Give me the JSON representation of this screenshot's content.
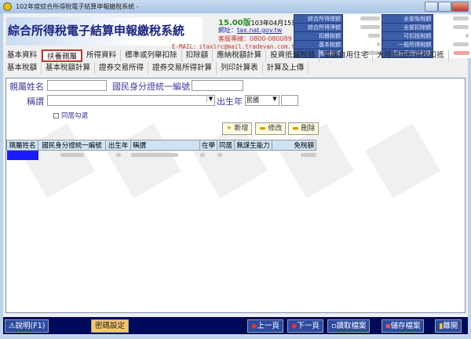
{
  "window": {
    "title": "102年度綜合所得稅電子結算申報繳稅系統 -"
  },
  "header": {
    "app_title": "綜合所得稅電子結算申報繳稅系統",
    "version": "15.00版",
    "build_date": "103年04月15日製",
    "website_label": "網址：",
    "website": "tax.nat.gov.tw",
    "hotline": "客服專線：0800-080089",
    "email": "E-MAIL：itaxirc@mail.tradevan.com.tw"
  },
  "summary": {
    "left": [
      "綜合所得總額",
      "綜合所得淨額",
      "扣繳稅額",
      "基本稅額",
      "應納稅額"
    ],
    "right": [
      "全部免稅額",
      "全部扣除額",
      "可扣抵稅額",
      "一般所得稅額",
      "應自行繳納稅額"
    ]
  },
  "tabs_row1": [
    "基本資料",
    "扶養親屬",
    "所得資料",
    "標準或列舉扣除",
    "扣除額",
    "應納稅額計算",
    "投資抵減稅額",
    "重購自用住宅",
    "大陸地區所得稅扣抵"
  ],
  "tabs_row2": [
    "基本稅額",
    "基本稅額計算",
    "證券交易所得",
    "證券交易所得計算",
    "列印計算表",
    "計算及上傳"
  ],
  "form": {
    "name_label": "親屬姓名",
    "id_label": "國民身分證統一編號",
    "title_label": "稱謂",
    "birth_label": "出生年",
    "era_value": "民國",
    "cohabit_label": "同居勾選",
    "add": "新增",
    "edit": "修改",
    "delete": "刪除"
  },
  "grid": {
    "columns": [
      "親屬姓名",
      "國民身分證統一編號",
      "出生年",
      "稱謂",
      "在學",
      "同居",
      "無謀生能力",
      "免稅額"
    ]
  },
  "footer": {
    "help": "說明(F1)",
    "password": "密碼設定",
    "prev": "上一頁",
    "next": "下一頁",
    "load": "讀取檔案",
    "save": "儲存檔案",
    "exit": "離開"
  },
  "colors": {
    "accent": "#000a5a",
    "selected_tab_border": "#c0392b",
    "label": "#3b3b9b"
  }
}
